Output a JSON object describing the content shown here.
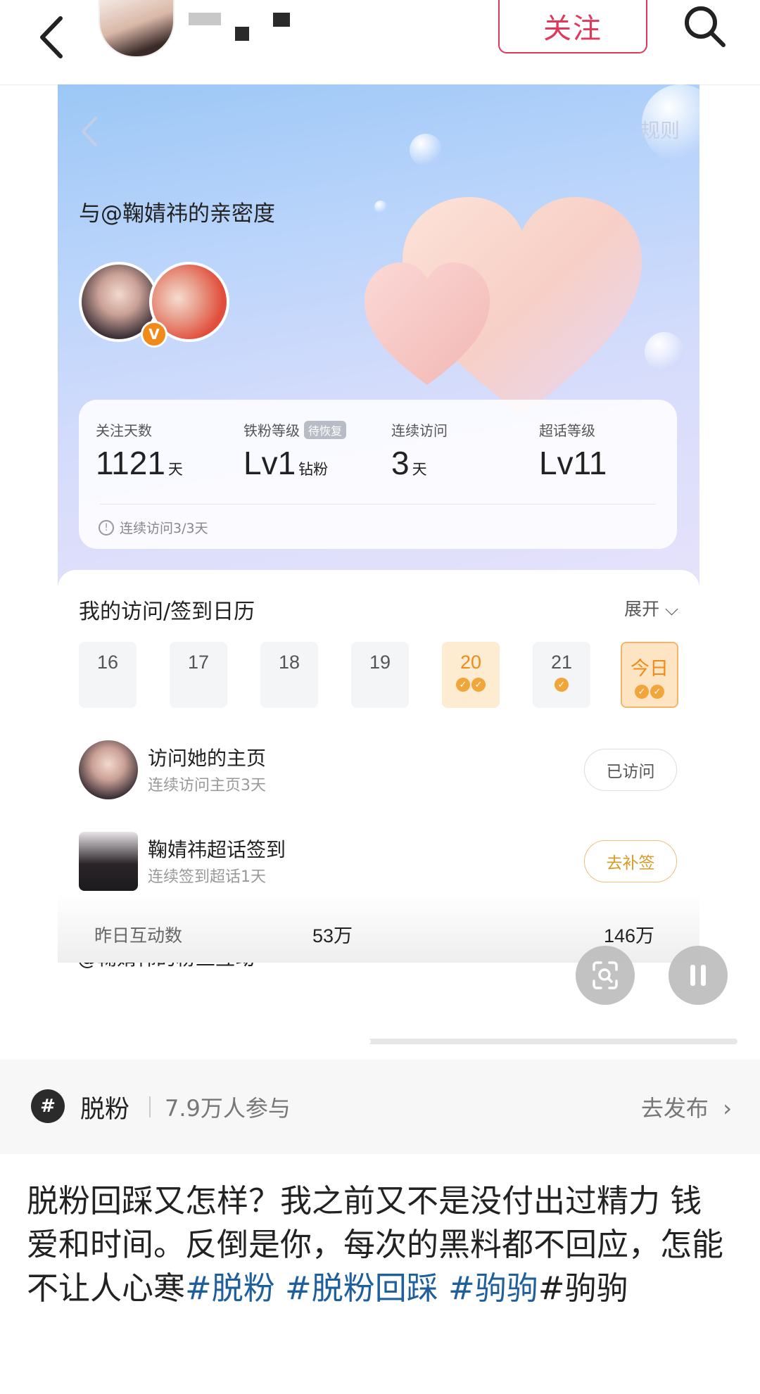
{
  "header": {
    "follow_label": "关注",
    "back_icon": "back-chevron-icon",
    "search_icon": "search-icon"
  },
  "intimacy_card": {
    "rule_label": "规则",
    "title": "与@鞠婧祎的亲密度",
    "stats": [
      {
        "label": "关注天数",
        "value": "1121",
        "unit": "天",
        "tag": ""
      },
      {
        "label": "铁粉等级",
        "value": "Lv1",
        "unit": "钻粉",
        "tag": "待恢复"
      },
      {
        "label": "连续访问",
        "value": "3",
        "unit": "天",
        "tag": ""
      },
      {
        "label": "超话等级",
        "value": "Lv11",
        "unit": "",
        "tag": ""
      }
    ],
    "tip": "连续访问3/3天"
  },
  "calendar": {
    "title": "我的访问/签到日历",
    "expand_label": "展开",
    "days": [
      {
        "label": "16",
        "checks": 0
      },
      {
        "label": "17",
        "checks": 0
      },
      {
        "label": "18",
        "checks": 0
      },
      {
        "label": "19",
        "checks": 0
      },
      {
        "label": "20",
        "checks": 2
      },
      {
        "label": "21",
        "checks": 1
      },
      {
        "label": "今日",
        "checks": 2
      }
    ]
  },
  "tasks": [
    {
      "title": "访问她的主页",
      "subtitle": "连续访问主页3天",
      "button": "已访问"
    },
    {
      "title": "鞠婧祎超话签到",
      "subtitle": "连续签到超话1天",
      "button": "去补签"
    }
  ],
  "fans": {
    "title": "@鞠婧祎的粉丝互动",
    "yesterday_label": "昨日互动数",
    "yesterday_value": "53万",
    "other_value": "146万"
  },
  "video_progress": 0.49,
  "topic": {
    "name": "脱粉",
    "participants": "7.9万人参与",
    "action": "去发布"
  },
  "post": {
    "text": "脱粉回踩又怎样？我之前又不是没付出过精力 钱 爱和时间。反倒是你，每次的黑料都不回应，怎能不让人心寒",
    "hashtags": [
      "#脱粉",
      " #脱粉回踩",
      " #驹驹"
    ],
    "tail": "#驹驹"
  }
}
